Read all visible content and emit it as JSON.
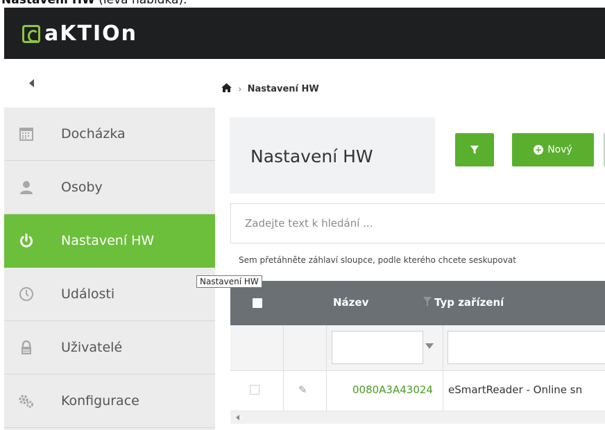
{
  "caption": {
    "bold": "Nastavení HW",
    "rest": "(levá nabídka)."
  },
  "brand": {
    "logo_text": "aKTIOn",
    "accent": "#8dc63f"
  },
  "sidebar": {
    "items": [
      {
        "label": "Docházka",
        "icon": "calendar-icon"
      },
      {
        "label": "Osoby",
        "icon": "person-icon"
      },
      {
        "label": "Nastavení HW",
        "icon": "power-icon",
        "active": true
      },
      {
        "label": "Události",
        "icon": "clock-icon"
      },
      {
        "label": "Uživatelé",
        "icon": "lock-icon"
      },
      {
        "label": "Konfigurace",
        "icon": "gears-icon"
      }
    ]
  },
  "tooltip": {
    "text": "Nastavení HW"
  },
  "breadcrumb": {
    "current": "Nastavení HW"
  },
  "page": {
    "title": "Nastavení HW"
  },
  "toolbar": {
    "new_label": "Nový"
  },
  "search": {
    "placeholder": "Zadejte text k hledání ..."
  },
  "grid": {
    "group_hint": "Sem přetáhněte záhlaví sloupce, podle kterého chcete seskupovat",
    "columns": {
      "name": "Název",
      "type": "Typ zařízení"
    },
    "rows": [
      {
        "name": "0080A3A43024",
        "type": "eSmartReader - Online sn"
      }
    ]
  },
  "colors": {
    "active_green": "#6bbf3a",
    "button_green": "#5ab02e",
    "header_gray": "#6b7075"
  }
}
